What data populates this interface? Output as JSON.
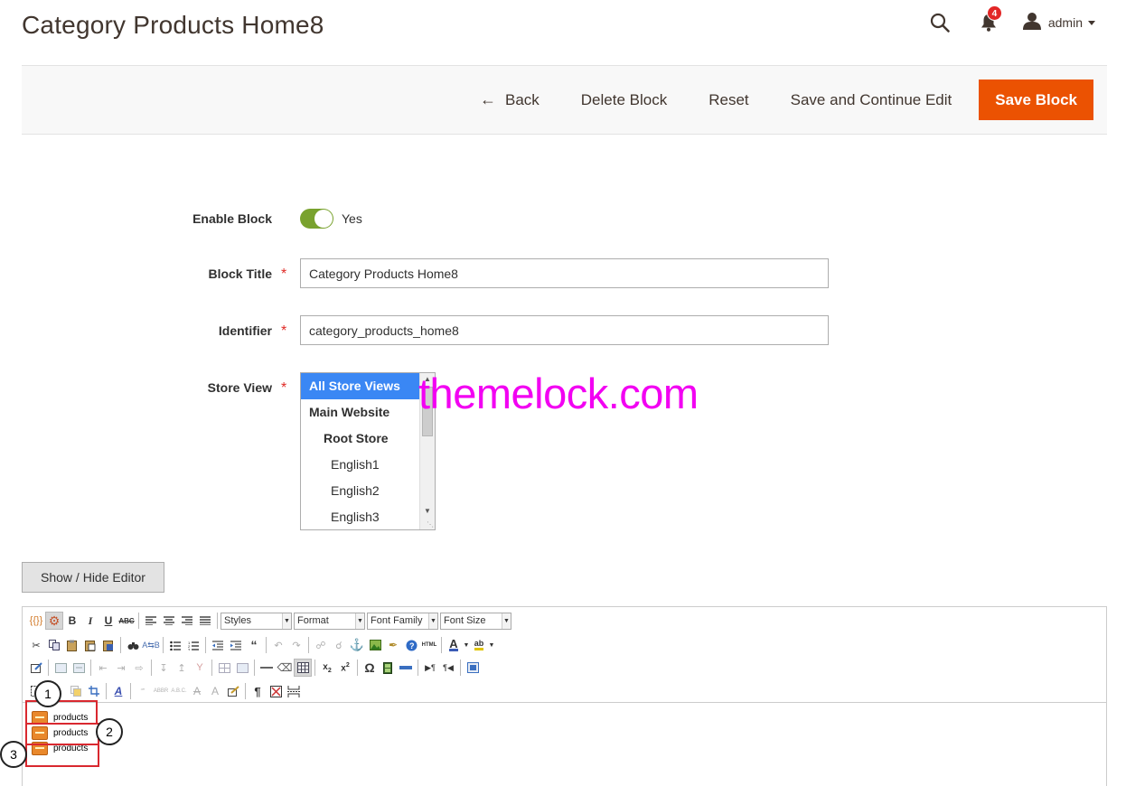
{
  "header": {
    "page_title": "Category Products Home8",
    "notification_count": "4",
    "user_name": "admin"
  },
  "action_bar": {
    "back_label": "Back",
    "delete_label": "Delete Block",
    "reset_label": "Reset",
    "save_continue_label": "Save and Continue Edit",
    "save_label": "Save Block"
  },
  "form": {
    "enable_block": {
      "label": "Enable Block",
      "value_text": "Yes",
      "enabled": true
    },
    "block_title": {
      "label": "Block Title",
      "value": "Category Products Home8"
    },
    "identifier": {
      "label": "Identifier",
      "value": "category_products_home8"
    },
    "store_view": {
      "label": "Store View",
      "options": [
        {
          "label": "All Store Views",
          "selected": true
        },
        {
          "label": "Main Website",
          "selected": false
        },
        {
          "label": "Root Store",
          "selected": false
        },
        {
          "label": "English1",
          "selected": false
        },
        {
          "label": "English2",
          "selected": false
        },
        {
          "label": "English3",
          "selected": false
        }
      ]
    }
  },
  "watermark": "themelock.com",
  "editor": {
    "toggle_label": "Show / Hide Editor",
    "selects": {
      "styles": "Styles",
      "format": "Format",
      "font_family": "Font Family",
      "font_size": "Font Size"
    },
    "content_widgets": [
      {
        "label": "products"
      },
      {
        "label": "products"
      },
      {
        "label": "products"
      }
    ],
    "callouts": [
      "1",
      "2",
      "3"
    ]
  },
  "colors": {
    "accent": "#eb5202",
    "toggle_on": "#79a22e",
    "selected_option": "#3a87f4",
    "watermark": "#f200f2",
    "badge": "#e22626",
    "callout_border": "#d9282f"
  }
}
